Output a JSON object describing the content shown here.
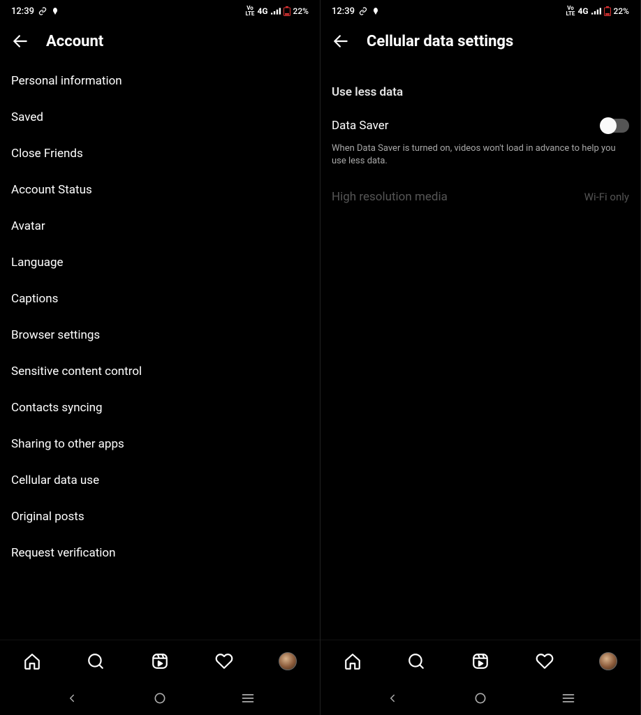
{
  "status": {
    "time": "12:39",
    "network_type": "4G",
    "lte_top": "Vo",
    "lte_bottom": "LTE",
    "battery": "22%"
  },
  "left": {
    "title": "Account",
    "items": [
      "Personal information",
      "Saved",
      "Close Friends",
      "Account Status",
      "Avatar",
      "Language",
      "Captions",
      "Browser settings",
      "Sensitive content control",
      "Contacts syncing",
      "Sharing to other apps",
      "Cellular data use",
      "Original posts",
      "Request verification"
    ]
  },
  "right": {
    "title": "Cellular data settings",
    "section": "Use less data",
    "data_saver_label": "Data Saver",
    "data_saver_helper": "When Data Saver is turned on, videos won't load in advance to help you use less data.",
    "high_res_label": "High resolution media",
    "high_res_value": "Wi-Fi only"
  }
}
